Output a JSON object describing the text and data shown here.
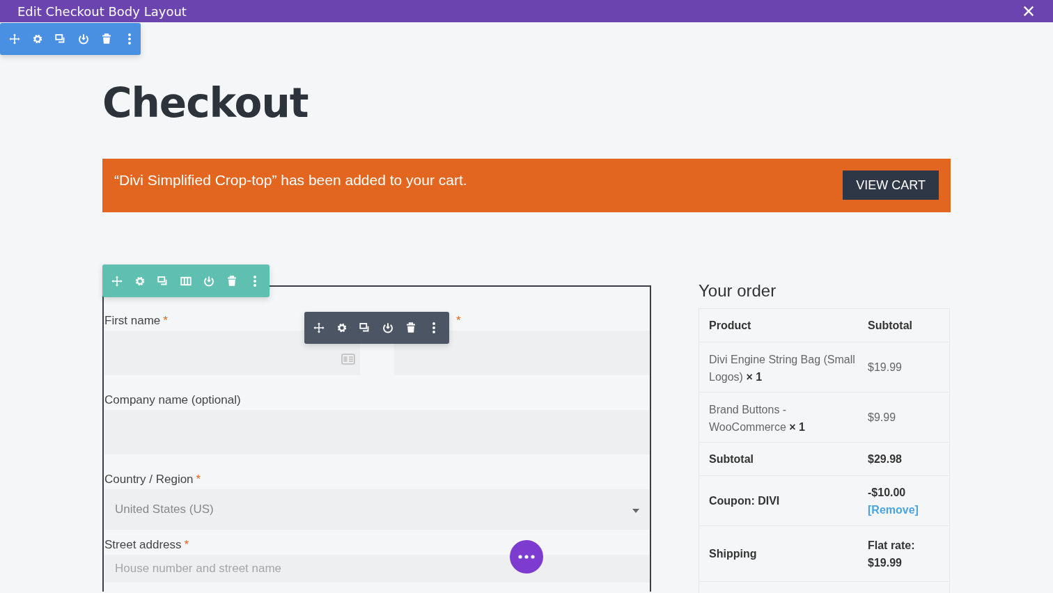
{
  "window": {
    "title": "Edit Checkout Body Layout"
  },
  "section_toolbar": {
    "tools": [
      {
        "kind": "move"
      },
      {
        "kind": "settings"
      },
      {
        "kind": "duplicate"
      },
      {
        "kind": "power"
      },
      {
        "kind": "delete"
      },
      {
        "kind": "more"
      }
    ]
  },
  "page": {
    "heading": "Checkout",
    "notice": {
      "message": "“Divi Simplified Crop-top” has been added to your cart.",
      "button": "VIEW CART"
    }
  },
  "row_toolbar": {
    "tools": [
      {
        "kind": "move"
      },
      {
        "kind": "settings"
      },
      {
        "kind": "duplicate"
      },
      {
        "kind": "columns"
      },
      {
        "kind": "power"
      },
      {
        "kind": "delete"
      },
      {
        "kind": "more"
      }
    ]
  },
  "module_toolbar": {
    "tools": [
      {
        "kind": "move"
      },
      {
        "kind": "settings"
      },
      {
        "kind": "duplicate"
      },
      {
        "kind": "power"
      },
      {
        "kind": "delete"
      },
      {
        "kind": "more"
      }
    ]
  },
  "billing": {
    "fields": [
      {
        "kind": "half",
        "label": "First name",
        "marker": "*"
      },
      {
        "kind": "half",
        "marker": "*"
      },
      {
        "kind": "text",
        "label": "Company name (optional)"
      },
      {
        "kind": "select",
        "label": "Country / Region",
        "marker": "*",
        "value": "United States (US)"
      },
      {
        "kind": "text",
        "label": "Street address",
        "marker": "*",
        "placeholder": "House number and street name"
      }
    ]
  },
  "order": {
    "heading": "Your order",
    "columns": [
      "Product",
      "Subtotal"
    ],
    "items": [
      {
        "name": "Divi Engine String Bag (Small Logos)",
        "quantity": "× 1",
        "subtotal": "$19.99"
      },
      {
        "name": "Brand Buttons - WooCommerce",
        "quantity": "× 1",
        "subtotal": "$9.99"
      }
    ],
    "totals": [
      {
        "label": "Subtotal",
        "value": "$29.98"
      },
      {
        "label": "Coupon: DIVI",
        "value": "-$10.00",
        "link": "[Remove]"
      },
      {
        "label": "Shipping",
        "value": "Flat rate: $19.99"
      }
    ]
  }
}
